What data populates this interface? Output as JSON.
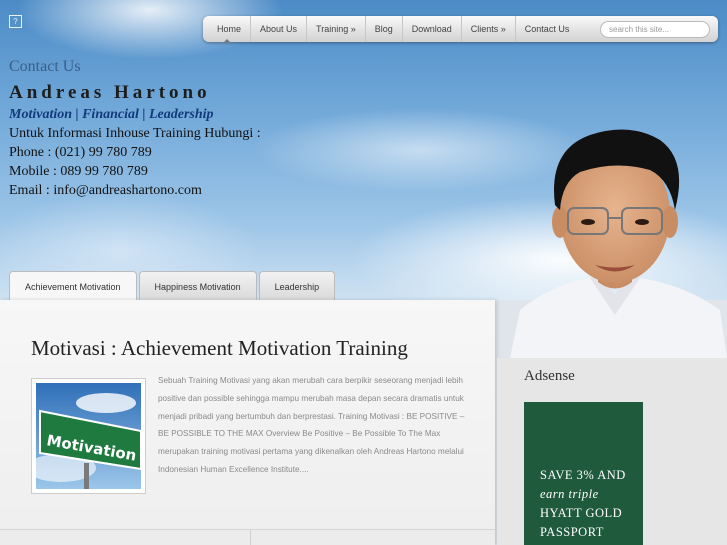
{
  "nav": {
    "items": [
      "Home",
      "About Us",
      "Training »",
      "Blog",
      "Download",
      "Clients »",
      "Contact Us"
    ],
    "active_index": 0,
    "search_placeholder": "search this site..."
  },
  "contact": {
    "title": "Contact Us",
    "name": "Andreas Hartono",
    "tagline": "Motivation | Financial | Leadership",
    "info": "Untuk Informasi Inhouse Training Hubungi :",
    "phone": "Phone : (021) 99 780 789",
    "mobile": "Mobile : 089 99 780 789",
    "email": "Email : info@andreashartono.com"
  },
  "tabs": [
    "Achievement Motivation",
    "Happiness Motivation",
    "Leadership"
  ],
  "post": {
    "title": "Motivasi : Achievement Motivation Training",
    "thumb_sign_text": "Motivation",
    "excerpt": "Sebuah Training Motivasi yang akan merubah cara berpikir seseorang menjadi lebih positive dan possible sehingga mampu merubah masa depan secara dramatis untuk menjadi pribadi yang bertumbuh dan berprestasi. Training Motivasi : BE POSITIVE – BE POSSIBLE TO THE MAX  Overview Be Positive – Be Possible To The Max merupakan training motivasi pertama yang dikenalkan oleh Andreas Hartono melalui Indonesian Human Excellence Institute...."
  },
  "sidebar": {
    "title": "Adsense",
    "ad": {
      "line1": "SAVE 3% AND",
      "line2": "earn triple",
      "line3": "HYATT GOLD",
      "line4": "PASSPORT"
    }
  },
  "colors": {
    "ad_bg": "#1f5a3d",
    "contact_title": "#3a5f86",
    "tagline": "#123a7a"
  }
}
